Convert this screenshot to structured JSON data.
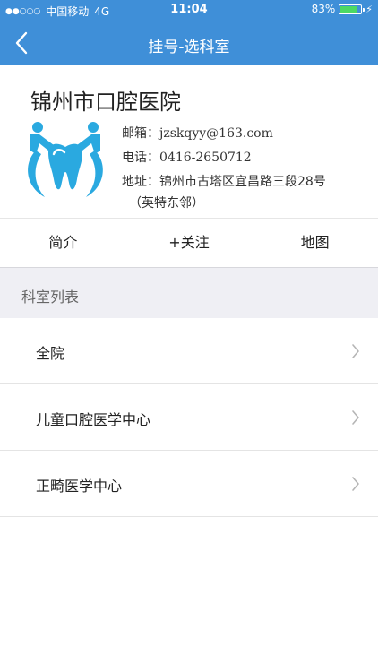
{
  "status_bar": {
    "carrier": "中国移动",
    "network": "4G",
    "time": "11:04",
    "battery_percent": "83%",
    "battery_level": 0.83
  },
  "nav": {
    "title": "挂号-选科室"
  },
  "hospital": {
    "name": "锦州市口腔医院",
    "email_label": "邮箱：",
    "email": "jzskqyy@163.com",
    "phone_label": "电话：",
    "phone": "0416-2650712",
    "address_label": "地址：",
    "address": "锦州市古塔区宜昌路三段28号",
    "address_note": "（英特东邻）"
  },
  "tabs": [
    {
      "label": "简介"
    },
    {
      "label": "+关注"
    },
    {
      "label": "地图"
    }
  ],
  "section": {
    "title": "科室列表"
  },
  "departments": [
    {
      "label": "全院"
    },
    {
      "label": "儿童口腔医学中心"
    },
    {
      "label": "正畸医学中心"
    }
  ],
  "colors": {
    "nav_bg": "#3f8fd8",
    "logo": "#2aa9e0",
    "section_bg": "#efeff4"
  }
}
